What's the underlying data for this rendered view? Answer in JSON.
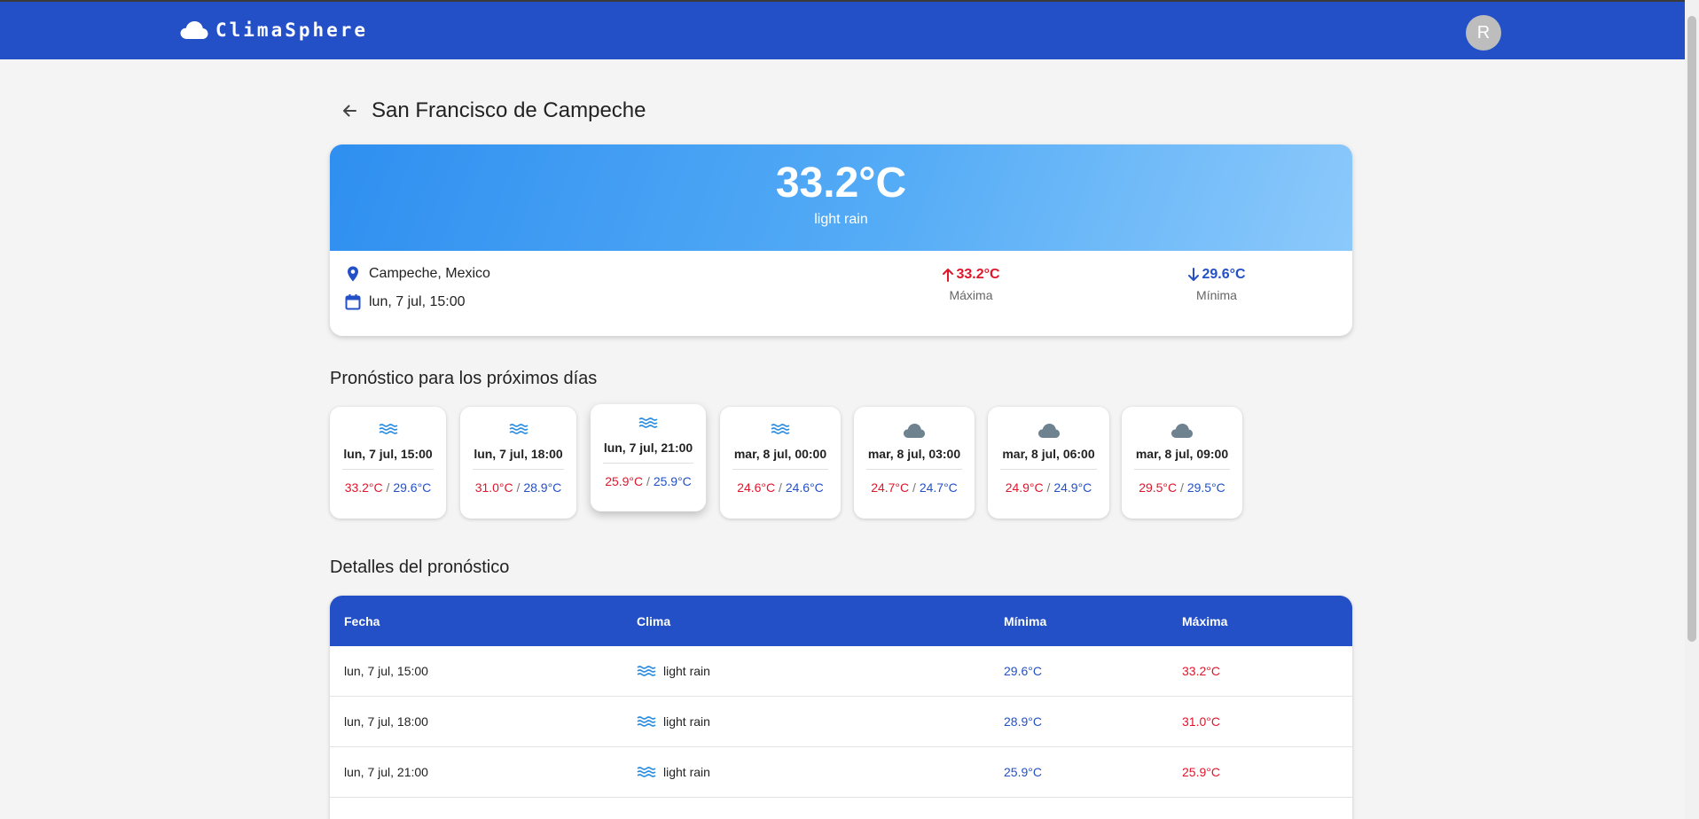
{
  "app": {
    "name": "ClimaSphere",
    "avatar_initial": "R"
  },
  "page": {
    "city": "San Francisco de Campeche"
  },
  "current": {
    "temperature": "33.2°C",
    "description": "light rain",
    "location": "Campeche, Mexico",
    "datetime": "lun, 7 jul, 15:00",
    "max": "33.2°C",
    "max_label": "Máxima",
    "min": "29.6°C",
    "min_label": "Mínima"
  },
  "forecast_title": "Pronóstico para los próximos días",
  "forecast": [
    {
      "date": "lun, 7 jul, 15:00",
      "max": "33.2°C",
      "min": "29.6°C",
      "icon": "waves-icon"
    },
    {
      "date": "lun, 7 jul, 18:00",
      "max": "31.0°C",
      "min": "28.9°C",
      "icon": "waves-icon"
    },
    {
      "date": "lun, 7 jul, 21:00",
      "max": "25.9°C",
      "min": "25.9°C",
      "icon": "waves-icon"
    },
    {
      "date": "mar, 8 jul, 00:00",
      "max": "24.6°C",
      "min": "24.6°C",
      "icon": "waves-icon"
    },
    {
      "date": "mar, 8 jul, 03:00",
      "max": "24.7°C",
      "min": "24.7°C",
      "icon": "cloud-icon"
    },
    {
      "date": "mar, 8 jul, 06:00",
      "max": "24.9°C",
      "min": "24.9°C",
      "icon": "cloud-icon"
    },
    {
      "date": "mar, 8 jul, 09:00",
      "max": "29.5°C",
      "min": "29.5°C",
      "icon": "cloud-icon"
    }
  ],
  "details_title": "Detalles del pronóstico",
  "table": {
    "headers": [
      "Fecha",
      "Clima",
      "Mínima",
      "Máxima"
    ],
    "rows": [
      {
        "date": "lun, 7 jul, 15:00",
        "weather": "light rain",
        "min": "29.6°C",
        "max": "33.2°C"
      },
      {
        "date": "lun, 7 jul, 18:00",
        "weather": "light rain",
        "min": "28.9°C",
        "max": "31.0°C"
      },
      {
        "date": "lun, 7 jul, 21:00",
        "weather": "light rain",
        "min": "25.9°C",
        "max": "25.9°C"
      }
    ]
  },
  "colors": {
    "primary": "#2350c7",
    "max_temp": "#e0162b",
    "min_temp": "#2350c7",
    "rain_icon": "#2a8de0",
    "cloud_icon": "#6e8290"
  }
}
